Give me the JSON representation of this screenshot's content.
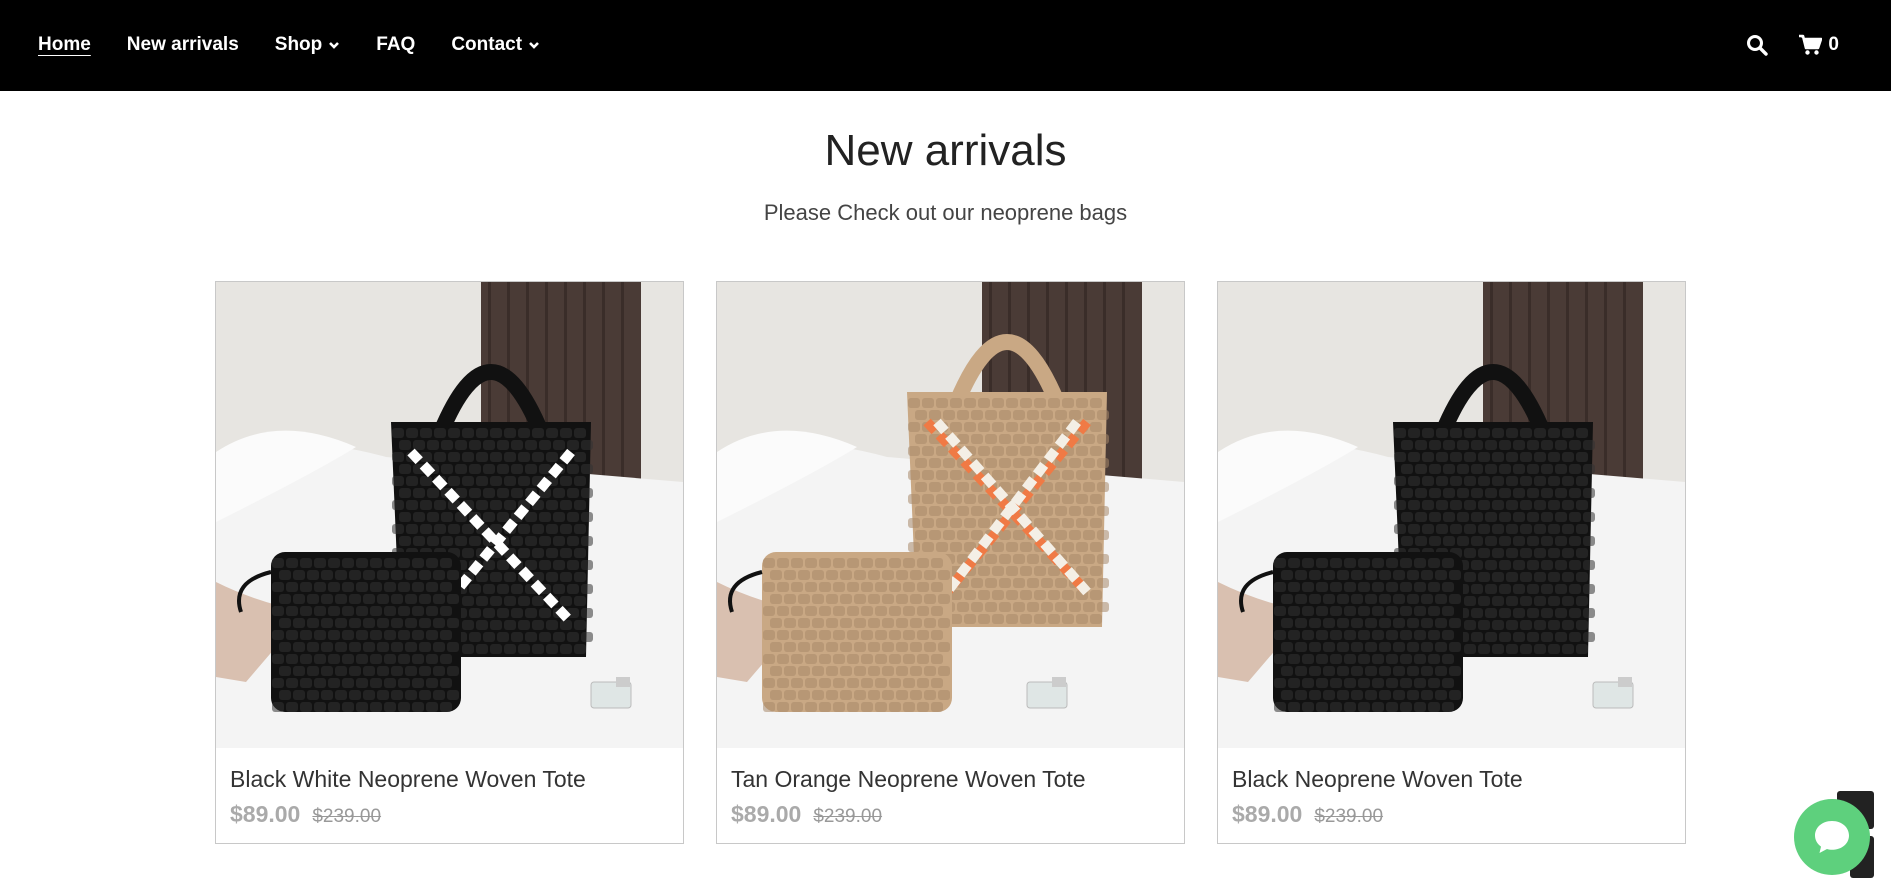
{
  "nav": {
    "links": [
      {
        "label": "Home",
        "active": true,
        "dropdown": false
      },
      {
        "label": "New arrivals",
        "active": false,
        "dropdown": false
      },
      {
        "label": "Shop",
        "active": false,
        "dropdown": true
      },
      {
        "label": "FAQ",
        "active": false,
        "dropdown": false
      },
      {
        "label": "Contact",
        "active": false,
        "dropdown": true
      }
    ],
    "search_icon": "search-icon",
    "cart_icon": "cart-icon",
    "cart_count": "0"
  },
  "main": {
    "title": "New arrivals",
    "subtitle": "Please Check out our neoprene bags"
  },
  "products": [
    {
      "name": "Black White Neoprene Woven Tote",
      "price": "$89.00",
      "old_price": "$239.00",
      "bag_color": "#111111",
      "pattern_colors": [
        "#ffffff"
      ]
    },
    {
      "name": "Tan Orange Neoprene Woven Tote",
      "price": "$89.00",
      "old_price": "$239.00",
      "bag_color": "#c9a884",
      "pattern_colors": [
        "#f07a45",
        "#f4efe6"
      ]
    },
    {
      "name": "Black Neoprene Woven Tote",
      "price": "$89.00",
      "old_price": "$239.00",
      "bag_color": "#111111",
      "pattern_colors": []
    }
  ],
  "chat": {
    "icon": "chat-bubble-icon",
    "color": "#5ed07d"
  }
}
